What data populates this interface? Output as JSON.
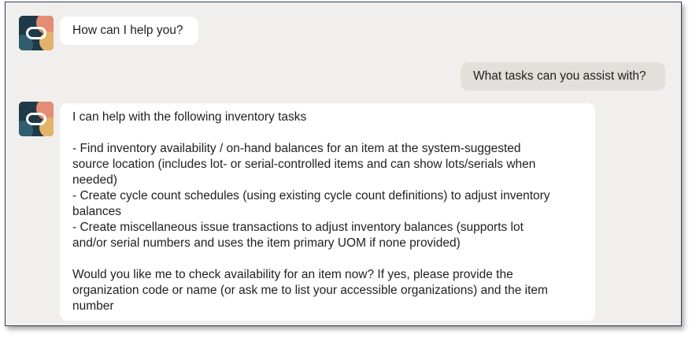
{
  "conversation": {
    "bot_greeting": "How can I help you?",
    "user_question": "What tasks can you assist with?",
    "bot_reply": {
      "intro": "I can help with the following inventory tasks",
      "lines": [
        "- Find inventory availability / on-hand balances for an item at the system-suggested",
        "source location (includes lot- or serial-controlled items and can show lots/serials when",
        "needed)",
        "- Create cycle count schedules (using existing cycle count definitions) to adjust inventory",
        "balances",
        "- Create miscellaneous issue transactions to adjust inventory balances (supports lot",
        "and/or serial numbers and uses the item primary UOM if none provided)"
      ],
      "closing_lines": [
        "Would you like me to check availability for an item now? If yes, please provide the",
        "organization code or name (or ask me to list your accessible organizations) and the item",
        "number"
      ]
    }
  },
  "icons": {
    "assistant_avatar": "oracle-assistant-avatar-icon"
  },
  "colors": {
    "background": "#f1efed",
    "bot_bubble": "#ffffff",
    "user_bubble": "#e3dfda",
    "frame_border": "#2c3e55"
  }
}
